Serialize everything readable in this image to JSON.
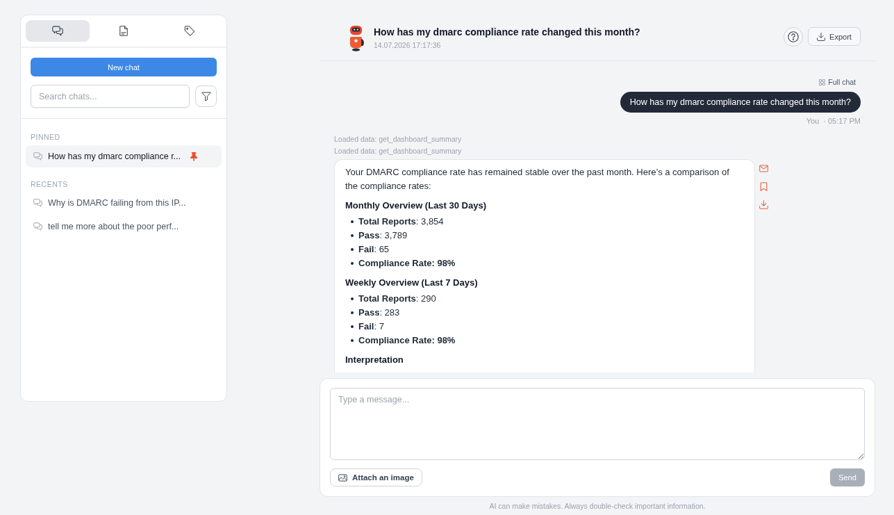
{
  "sidebar": {
    "tabs": [
      {
        "kind": "chats",
        "selected": true
      },
      {
        "kind": "documents",
        "selected": false
      },
      {
        "kind": "tags",
        "selected": false
      }
    ],
    "new_chat_button": "New chat",
    "search": {
      "placeholder": "Search chats..."
    },
    "chat_groups": [
      {
        "heading": "PINNED",
        "chats": [
          {
            "title": "How has my dmarc compliance r...",
            "selected": true,
            "pinned": true
          }
        ]
      },
      {
        "heading": "RECENTS",
        "chats": [
          {
            "title": "Why is DMARC failing from this IP...",
            "selected": false,
            "pinned": false
          },
          {
            "title": "tell me more about the poor perf...",
            "selected": false,
            "pinned": false
          }
        ]
      }
    ]
  },
  "header": {
    "title": "How has my dmarc compliance rate changed this month?",
    "timestamp": "14.07.2026 17:17:36",
    "export_button": "Export"
  },
  "conversation": {
    "full_chat_link": "Full chat",
    "user_message": {
      "text": "How has my dmarc compliance rate changed this month?",
      "author": "You",
      "time": "· 05:17 PM"
    },
    "tool_notes": [
      "Loaded data: get_dashboard_summary",
      "Loaded data: get_dashboard_summary"
    ],
    "assistant_message": {
      "intro": "Your DMARC compliance rate has remained stable over the past month. Here’s a comparison of the compliance rates:",
      "sections": [
        {
          "heading": "Monthly Overview (Last 30 Days)",
          "items": [
            "**Total Reports**: 3,854",
            "**Pass**: 3,789",
            "**Fail**: 65",
            "**Compliance Rate: 98%**"
          ]
        },
        {
          "heading": "Weekly Overview (Last 7 Days)",
          "items": [
            "**Total Reports**: 290",
            "**Pass**: 283",
            "**Fail**: 7",
            "**Compliance Rate: 98%**"
          ]
        }
      ],
      "closing_heading": "Interpretation"
    }
  },
  "composer": {
    "placeholder": "Type a message...",
    "attach_button": "Attach an image",
    "send_button": {
      "label": "Send",
      "disabled": true
    }
  },
  "disclaimer": "AI can make mistakes. Always double-check important information."
}
